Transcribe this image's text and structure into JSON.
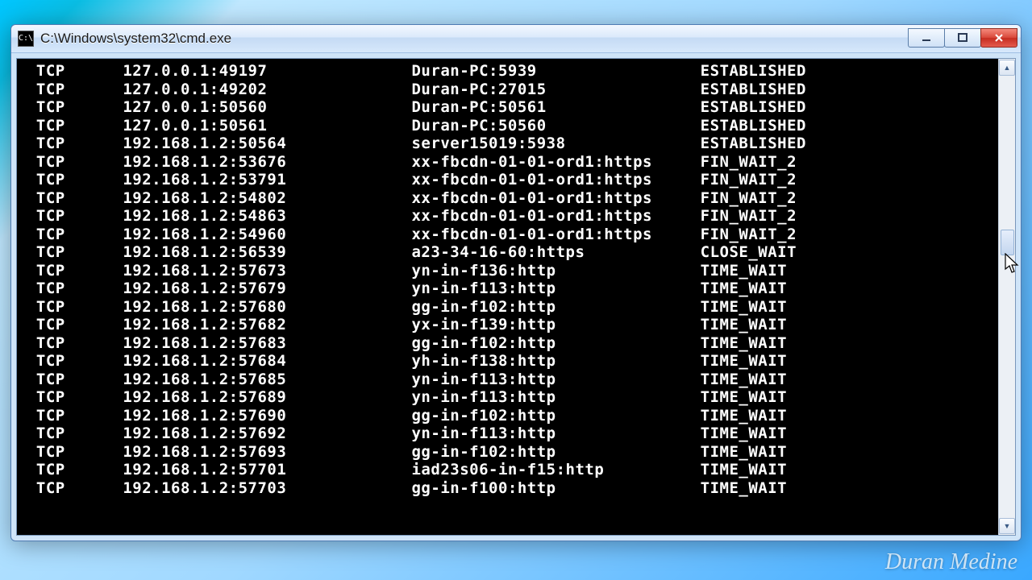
{
  "window": {
    "title": "C:\\Windows\\system32\\cmd.exe"
  },
  "columns": {
    "proto_w": 9,
    "local_w": 30,
    "remote_w": 30
  },
  "rows": [
    {
      "proto": "TCP",
      "local": "127.0.0.1:49197",
      "remote": "Duran-PC:5939",
      "state": "ESTABLISHED"
    },
    {
      "proto": "TCP",
      "local": "127.0.0.1:49202",
      "remote": "Duran-PC:27015",
      "state": "ESTABLISHED"
    },
    {
      "proto": "TCP",
      "local": "127.0.0.1:50560",
      "remote": "Duran-PC:50561",
      "state": "ESTABLISHED"
    },
    {
      "proto": "TCP",
      "local": "127.0.0.1:50561",
      "remote": "Duran-PC:50560",
      "state": "ESTABLISHED"
    },
    {
      "proto": "TCP",
      "local": "192.168.1.2:50564",
      "remote": "server15019:5938",
      "state": "ESTABLISHED"
    },
    {
      "proto": "TCP",
      "local": "192.168.1.2:53676",
      "remote": "xx-fbcdn-01-01-ord1:https",
      "state": "FIN_WAIT_2"
    },
    {
      "proto": "TCP",
      "local": "192.168.1.2:53791",
      "remote": "xx-fbcdn-01-01-ord1:https",
      "state": "FIN_WAIT_2"
    },
    {
      "proto": "TCP",
      "local": "192.168.1.2:54802",
      "remote": "xx-fbcdn-01-01-ord1:https",
      "state": "FIN_WAIT_2"
    },
    {
      "proto": "TCP",
      "local": "192.168.1.2:54863",
      "remote": "xx-fbcdn-01-01-ord1:https",
      "state": "FIN_WAIT_2"
    },
    {
      "proto": "TCP",
      "local": "192.168.1.2:54960",
      "remote": "xx-fbcdn-01-01-ord1:https",
      "state": "FIN_WAIT_2"
    },
    {
      "proto": "TCP",
      "local": "192.168.1.2:56539",
      "remote": "a23-34-16-60:https",
      "state": "CLOSE_WAIT"
    },
    {
      "proto": "TCP",
      "local": "192.168.1.2:57673",
      "remote": "yn-in-f136:http",
      "state": "TIME_WAIT"
    },
    {
      "proto": "TCP",
      "local": "192.168.1.2:57679",
      "remote": "yn-in-f113:http",
      "state": "TIME_WAIT"
    },
    {
      "proto": "TCP",
      "local": "192.168.1.2:57680",
      "remote": "gg-in-f102:http",
      "state": "TIME_WAIT"
    },
    {
      "proto": "TCP",
      "local": "192.168.1.2:57682",
      "remote": "yx-in-f139:http",
      "state": "TIME_WAIT"
    },
    {
      "proto": "TCP",
      "local": "192.168.1.2:57683",
      "remote": "gg-in-f102:http",
      "state": "TIME_WAIT"
    },
    {
      "proto": "TCP",
      "local": "192.168.1.2:57684",
      "remote": "yh-in-f138:http",
      "state": "TIME_WAIT"
    },
    {
      "proto": "TCP",
      "local": "192.168.1.2:57685",
      "remote": "yn-in-f113:http",
      "state": "TIME_WAIT"
    },
    {
      "proto": "TCP",
      "local": "192.168.1.2:57689",
      "remote": "yn-in-f113:http",
      "state": "TIME_WAIT"
    },
    {
      "proto": "TCP",
      "local": "192.168.1.2:57690",
      "remote": "gg-in-f102:http",
      "state": "TIME_WAIT"
    },
    {
      "proto": "TCP",
      "local": "192.168.1.2:57692",
      "remote": "yn-in-f113:http",
      "state": "TIME_WAIT"
    },
    {
      "proto": "TCP",
      "local": "192.168.1.2:57693",
      "remote": "gg-in-f102:http",
      "state": "TIME_WAIT"
    },
    {
      "proto": "TCP",
      "local": "192.168.1.2:57701",
      "remote": "iad23s06-in-f15:http",
      "state": "TIME_WAIT"
    },
    {
      "proto": "TCP",
      "local": "192.168.1.2:57703",
      "remote": "gg-in-f100:http",
      "state": "TIME_WAIT"
    }
  ],
  "watermark": "Duran Medine"
}
